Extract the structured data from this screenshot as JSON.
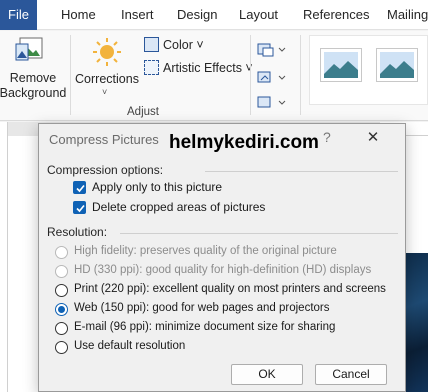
{
  "ribbon_tabs": {
    "file": "File",
    "home": "Home",
    "insert": "Insert",
    "design": "Design",
    "layout": "Layout",
    "references": "References",
    "mailings": "Mailings"
  },
  "ribbon": {
    "remove_background_line1": "Remove",
    "remove_background_line2": "Background",
    "corrections": "Corrections",
    "color": "Color ˅",
    "artistic_effects": "Artistic Effects ˅",
    "group_adjust": "Adjust"
  },
  "ruler": {
    "mark": "5"
  },
  "dialog": {
    "title": "Compress Pictures",
    "help_glyph": "?",
    "close_glyph": "✕",
    "watermark": "helmykediri.com",
    "compression_label": "Compression options:",
    "apply_only": "Apply only to this picture",
    "apply_only_checked": true,
    "delete_cropped": "Delete cropped areas of pictures",
    "delete_cropped_checked": true,
    "resolution_label": "Resolution:",
    "resolutions": [
      {
        "label": "High fidelity: preserves quality of the original picture",
        "disabled": true,
        "selected": false
      },
      {
        "label": "HD (330 ppi): good quality for high-definition (HD) displays",
        "disabled": true,
        "selected": false
      },
      {
        "label": "Print (220 ppi): excellent quality on most printers and screens",
        "disabled": false,
        "selected": false
      },
      {
        "label": "Web (150 ppi): good for web pages and projectors",
        "disabled": false,
        "selected": true
      },
      {
        "label": "E-mail (96 ppi): minimize document size for sharing",
        "disabled": false,
        "selected": false
      },
      {
        "label": "Use default resolution",
        "disabled": false,
        "selected": false
      }
    ],
    "ok_label": "OK",
    "cancel_label": "Cancel"
  },
  "colors": {
    "accent": "#0f62b5",
    "file_tab": "#2b579a"
  }
}
